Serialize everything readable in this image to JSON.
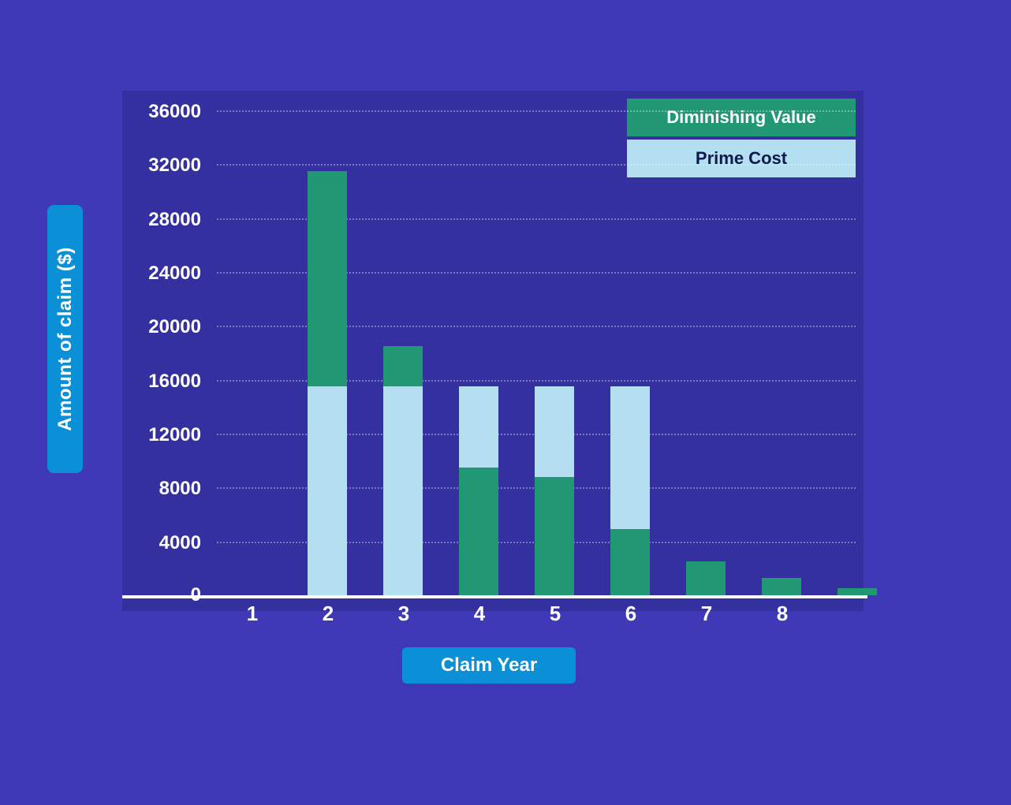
{
  "chart_data": {
    "type": "bar",
    "categories": [
      "1",
      "2",
      "3",
      "4",
      "5",
      "6",
      "7",
      "8"
    ],
    "series": [
      {
        "name": "Diminishing Value",
        "color": "#219873",
        "values": [
          31500,
          18500,
          9500,
          8800,
          4900,
          2500,
          1300,
          500
        ]
      },
      {
        "name": "Prime Cost",
        "color": "#b3dff0",
        "values": [
          15500,
          15500,
          15500,
          15500,
          15500,
          0,
          0,
          0
        ]
      }
    ],
    "xlabel": "Claim Year",
    "ylabel": "Amount of claim ($)",
    "ylim": [
      0,
      36000
    ],
    "yticks": [
      0,
      4000,
      8000,
      12000,
      16000,
      20000,
      24000,
      28000,
      32000,
      36000
    ],
    "grid": true,
    "legend_position": "top-right"
  },
  "labels": {
    "yaxis": "Amount of claim ($)",
    "xaxis": "Claim Year",
    "legend_dv": "Diminishing Value",
    "legend_pc": "Prime Cost",
    "yticks": {
      "t0": "0",
      "t1": "4000",
      "t2": "8000",
      "t3": "12000",
      "t4": "16000",
      "t5": "20000",
      "t6": "24000",
      "t7": "28000",
      "t8": "32000",
      "t9": "36000"
    },
    "xticks": {
      "c1": "1",
      "c2": "2",
      "c3": "3",
      "c4": "4",
      "c5": "5",
      "c6": "6",
      "c7": "7",
      "c8": "8"
    }
  }
}
